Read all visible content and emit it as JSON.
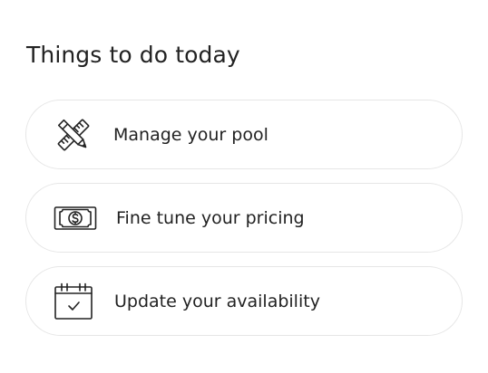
{
  "section": {
    "title": "Things to do today"
  },
  "tasks": [
    {
      "label": "Manage your pool",
      "icon": "pencil-ruler-icon"
    },
    {
      "label": "Fine tune your pricing",
      "icon": "dollar-bill-icon"
    },
    {
      "label": "Update your availability",
      "icon": "calendar-check-icon"
    }
  ],
  "colors": {
    "text": "#222222",
    "border": "#e6e6e6",
    "background": "#ffffff"
  }
}
